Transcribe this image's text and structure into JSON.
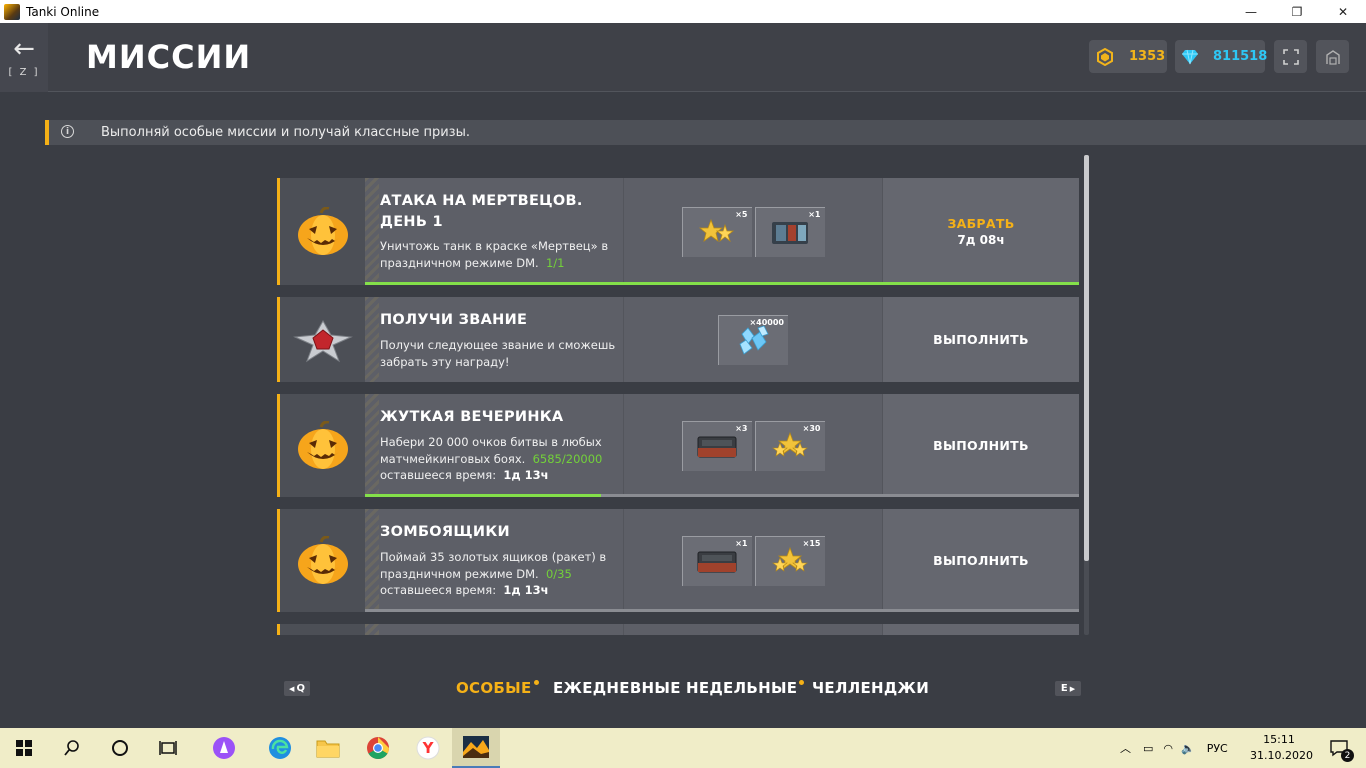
{
  "window": {
    "title": "Tanki Online",
    "minimize_glyph": "—",
    "restore_glyph": "❐",
    "close_glyph": "✕"
  },
  "header": {
    "back_hotkey": "[ Z ]",
    "title": "МИССИИ",
    "crystals": "1353",
    "rubies": "811518"
  },
  "info": {
    "text": "Выполняй особые миссии и получай классные призы."
  },
  "missions": [
    {
      "icon": "pumpkin-icon",
      "title": "АТАКА НА МЕРТВЕЦОВ. ДЕНЬ 1",
      "desc": "Уничтожь танк в краске «Мертвец» в праздничном режиме DM.",
      "progress": "1/1",
      "progress_fraction": 1.0,
      "rewards": [
        {
          "icon": "stars-icon",
          "qty": "×5"
        },
        {
          "icon": "paint-icon",
          "qty": "×1"
        }
      ],
      "action": "ЗАБРАТЬ",
      "timer": "7д 08ч"
    },
    {
      "icon": "rank-icon",
      "title": "ПОЛУЧИ ЗВАНИЕ",
      "desc": "Получи следующее звание и сможешь забрать эту награду!",
      "rewards": [
        {
          "icon": "crystals-icon",
          "qty": "×40000"
        }
      ],
      "action": "ВЫПОЛНИТЬ"
    },
    {
      "icon": "pumpkin-icon",
      "title": "ЖУТКАЯ ВЕЧЕРИНКА",
      "desc": "Набери 20 000 очков битвы в любых матчмейкинговых боях.",
      "progress": "6585/20000",
      "progress_fraction": 0.33,
      "time_label": "оставшееся время:",
      "time_value": "1д 13ч",
      "rewards": [
        {
          "icon": "container-icon",
          "qty": "×3"
        },
        {
          "icon": "stars-icon",
          "qty": "×30"
        }
      ],
      "action": "ВЫПОЛНИТЬ"
    },
    {
      "icon": "pumpkin-icon",
      "title": "ЗОМБОЯЩИКИ",
      "desc": "Поймай 35 золотых ящиков (ракет) в праздничном режиме DM.",
      "progress": "0/35",
      "progress_fraction": 0.0,
      "time_label": "оставшееся время:",
      "time_value": "1д 13ч",
      "rewards": [
        {
          "icon": "container-icon",
          "qty": "×1"
        },
        {
          "icon": "stars-icon",
          "qty": "×15"
        }
      ],
      "action": "ВЫПОЛНИТЬ"
    }
  ],
  "tabs": {
    "prev_key": "Q",
    "next_key": "E",
    "special": "ОСОБЫЕ",
    "daily": "ЕЖЕДНЕВНЫЕ",
    "weekly": "НЕДЕЛЬНЫЕ",
    "challenges": "ЧЕЛЛЕНДЖИ"
  },
  "taskbar": {
    "language": "РУС",
    "time": "15:11",
    "date": "31.10.2020",
    "notifications": "2"
  },
  "colors": {
    "accent": "#f5b117",
    "progress_green": "#84e04a",
    "crystal_blue": "#2ec7f5"
  }
}
